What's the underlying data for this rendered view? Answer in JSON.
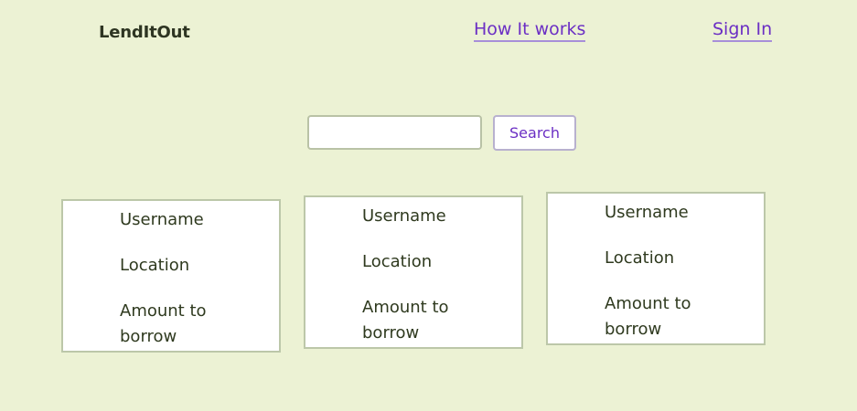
{
  "header": {
    "brand": "LendItOut",
    "nav": {
      "how_it_works": "How It works",
      "sign_in": "Sign In"
    }
  },
  "search": {
    "value": "",
    "placeholder": "",
    "button_label": "Search"
  },
  "cards": [
    {
      "username_label": "Username",
      "location_label": "Location",
      "amount_label": "Amount to borrow"
    },
    {
      "username_label": "Username",
      "location_label": "Location",
      "amount_label": "Amount to borrow"
    },
    {
      "username_label": "Username",
      "location_label": "Location",
      "amount_label": "Amount to borrow"
    }
  ],
  "colors": {
    "background": "#ecf2d4",
    "accent": "#6b2fc4",
    "card_border": "#bcc7a9",
    "text": "#2f3a1f"
  }
}
